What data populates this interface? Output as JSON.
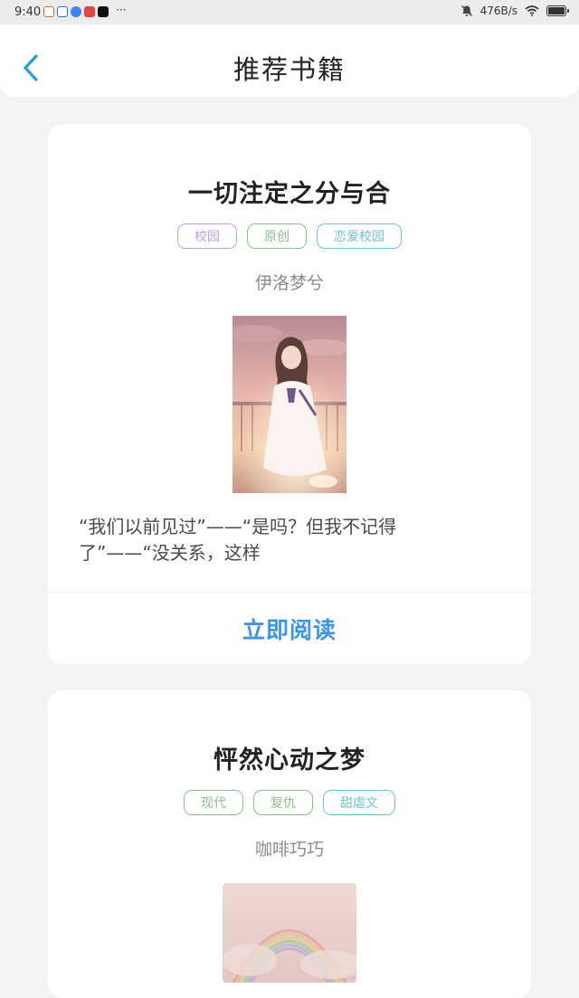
{
  "status_bar": {
    "time": "9:40",
    "more": "···",
    "speed": "476B/s",
    "app_colors": [
      "#e8622c",
      "#2f6fe0",
      "#3a86f0",
      "#e64444",
      "#111111"
    ]
  },
  "header": {
    "title": "推荐书籍"
  },
  "books": [
    {
      "title": "一切注定之分与合",
      "tags": [
        {
          "label": "校园",
          "color": "#c79be0"
        },
        {
          "label": "原创",
          "color": "#8cc08c"
        },
        {
          "label": "恋爱校园",
          "color": "#6fc3d6"
        }
      ],
      "author": "伊洛梦兮",
      "description": "“我们以前见过”——“是吗？但我不记得了”——“没关系，这样",
      "read_label": "立即阅读"
    },
    {
      "title": "怦然心动之梦",
      "tags": [
        {
          "label": "现代",
          "color": "#8cc08c"
        },
        {
          "label": "复仇",
          "color": "#8cc08c"
        },
        {
          "label": "甜虐文",
          "color": "#6fc3d6"
        }
      ],
      "author": "咖啡巧巧"
    }
  ],
  "colors": {
    "accent": "#3a95e8",
    "background": "#f3f3f3"
  }
}
